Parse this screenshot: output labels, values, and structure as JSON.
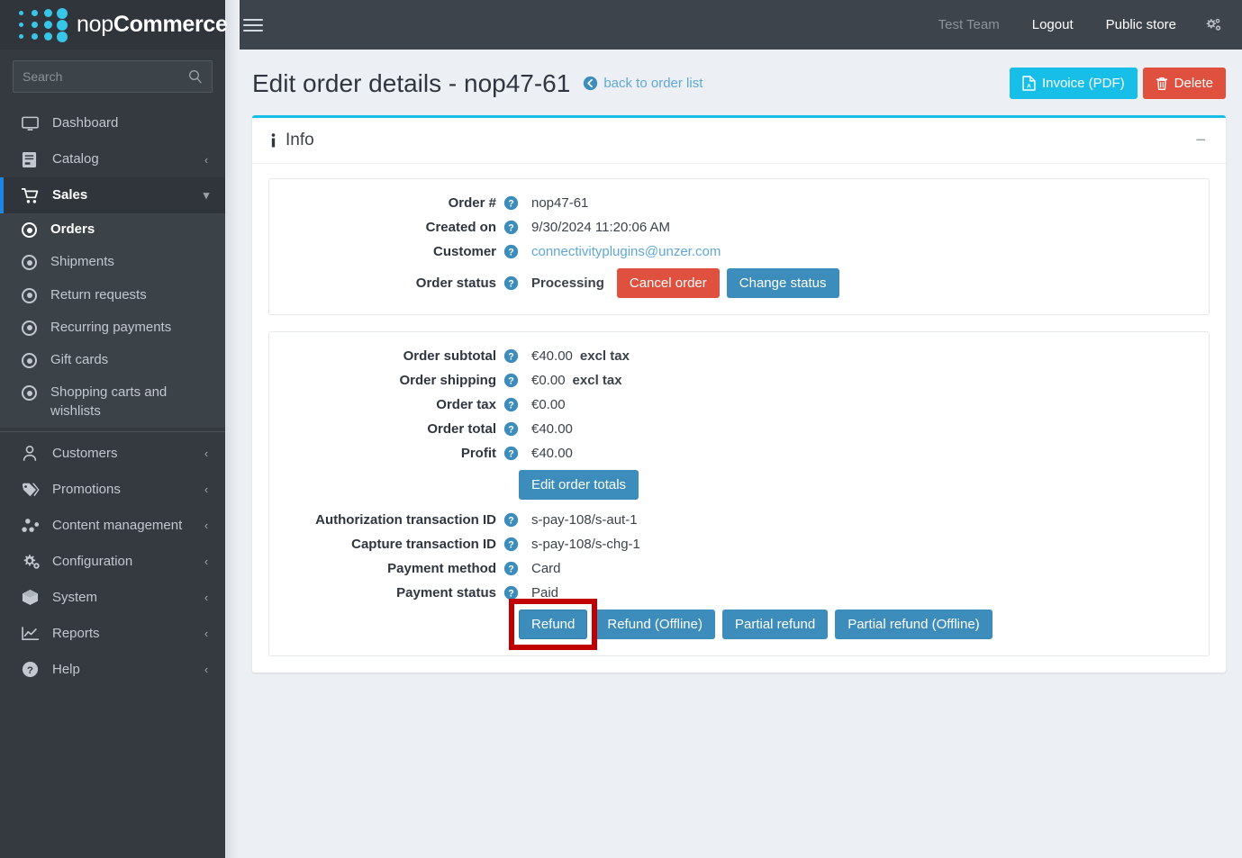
{
  "brand": {
    "name_light": "nop",
    "name_bold": "Commerce"
  },
  "search": {
    "placeholder": "Search",
    "value": ""
  },
  "sidebar": {
    "items": [
      {
        "label": "Dashboard",
        "icon": "monitor-icon",
        "caret": ""
      },
      {
        "label": "Catalog",
        "icon": "book-icon",
        "caret": "‹"
      },
      {
        "label": "Sales",
        "icon": "cart-icon",
        "caret": "∨",
        "open": true
      }
    ],
    "sales_children": [
      {
        "label": "Orders",
        "active": true
      },
      {
        "label": "Shipments",
        "active": false
      },
      {
        "label": "Return requests",
        "active": false
      },
      {
        "label": "Recurring payments",
        "active": false
      },
      {
        "label": "Gift cards",
        "active": false
      },
      {
        "label": "Shopping carts and wishlists",
        "active": false
      }
    ],
    "items_bottom": [
      {
        "label": "Customers",
        "icon": "user-icon",
        "caret": "‹"
      },
      {
        "label": "Promotions",
        "icon": "tag-icon",
        "caret": "‹"
      },
      {
        "label": "Content management",
        "icon": "nodes-icon",
        "caret": "‹"
      },
      {
        "label": "Configuration",
        "icon": "cogs-icon",
        "caret": "‹"
      },
      {
        "label": "System",
        "icon": "box-icon",
        "caret": "‹"
      },
      {
        "label": "Reports",
        "icon": "chart-icon",
        "caret": "‹"
      },
      {
        "label": "Help",
        "icon": "question-circle-icon",
        "caret": "‹"
      }
    ]
  },
  "topbar": {
    "user": "Test Team",
    "logout": "Logout",
    "public_store": "Public store",
    "gear_icon": "cogs-icon",
    "menu_icon": "hamburger-icon"
  },
  "page": {
    "title": "Edit order details - nop47-61",
    "back_link": "back to order list",
    "invoice_button": "Invoice (PDF)",
    "delete_button": "Delete"
  },
  "panel": {
    "title": "Info",
    "minimize": "−"
  },
  "order_info": {
    "rows": [
      {
        "label": "Order #",
        "value": "nop47-61"
      },
      {
        "label": "Created on",
        "value": "9/30/2024 11:20:06 AM"
      },
      {
        "label": "Customer",
        "value": "connectivityplugins@unzer.com",
        "is_link": true
      },
      {
        "label": "Order status",
        "value": "Processing",
        "bold": true
      }
    ],
    "cancel_order_button": "Cancel order",
    "change_status_button": "Change status"
  },
  "order_totals": {
    "rows": [
      {
        "label": "Order subtotal",
        "value": "€40.00",
        "suffix": "excl tax"
      },
      {
        "label": "Order shipping",
        "value": "€0.00",
        "suffix": "excl tax"
      },
      {
        "label": "Order tax",
        "value": "€0.00",
        "suffix": ""
      },
      {
        "label": "Order total",
        "value": "€40.00",
        "suffix": ""
      },
      {
        "label": "Profit",
        "value": "€40.00",
        "suffix": ""
      }
    ],
    "edit_order_totals_button": "Edit order totals",
    "payment_rows": [
      {
        "label": "Authorization transaction ID",
        "value": "s-pay-108/s-aut-1"
      },
      {
        "label": "Capture transaction ID",
        "value": "s-pay-108/s-chg-1"
      },
      {
        "label": "Payment method",
        "value": "Card"
      },
      {
        "label": "Payment status",
        "value": "Paid"
      }
    ],
    "refund_buttons": [
      {
        "label": "Refund",
        "highlighted": true
      },
      {
        "label": "Refund (Offline)",
        "highlighted": false
      },
      {
        "label": "Partial refund",
        "highlighted": false
      },
      {
        "label": "Partial refund (Offline)",
        "highlighted": false
      }
    ]
  },
  "colors": {
    "accent_cyan": "#17bee8",
    "primary_blue": "#3c8dbc",
    "danger_red": "#e0503f",
    "annotation_red": "#c00000",
    "sidebar_bg": "#343a40",
    "link_blue": "#5fa8d6"
  }
}
